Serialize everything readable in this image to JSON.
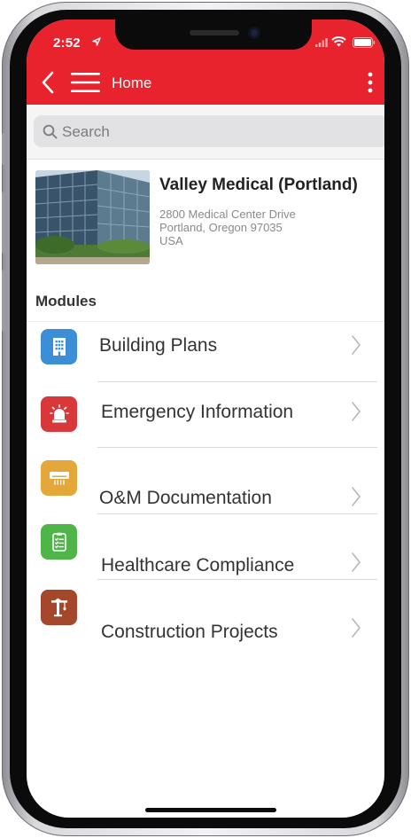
{
  "status_bar": {
    "time": "2:52"
  },
  "nav": {
    "title": "Home"
  },
  "search": {
    "placeholder": "Search"
  },
  "facility": {
    "name": "Valley Medical (Portland)",
    "address_line1": "2800 Medical Center Drive",
    "address_line2": "Portland, Oregon 97035",
    "country": "USA"
  },
  "modules": {
    "heading": "Modules",
    "items": [
      {
        "label": "Building Plans",
        "icon": "building-icon",
        "color": "#3c8fd6"
      },
      {
        "label": "Emergency Information",
        "icon": "siren-icon",
        "color": "#d9383a"
      },
      {
        "label": "O&M Documentation",
        "icon": "air-conditioner-icon",
        "color": "#e4a73a"
      },
      {
        "label": "Healthcare Compliance",
        "icon": "checklist-icon",
        "color": "#4fb548"
      },
      {
        "label": "Construction Projects",
        "icon": "crane-icon",
        "color": "#a4472a"
      }
    ]
  },
  "colors": {
    "header": "#e9232e",
    "search_bg": "#e2e2e4"
  }
}
